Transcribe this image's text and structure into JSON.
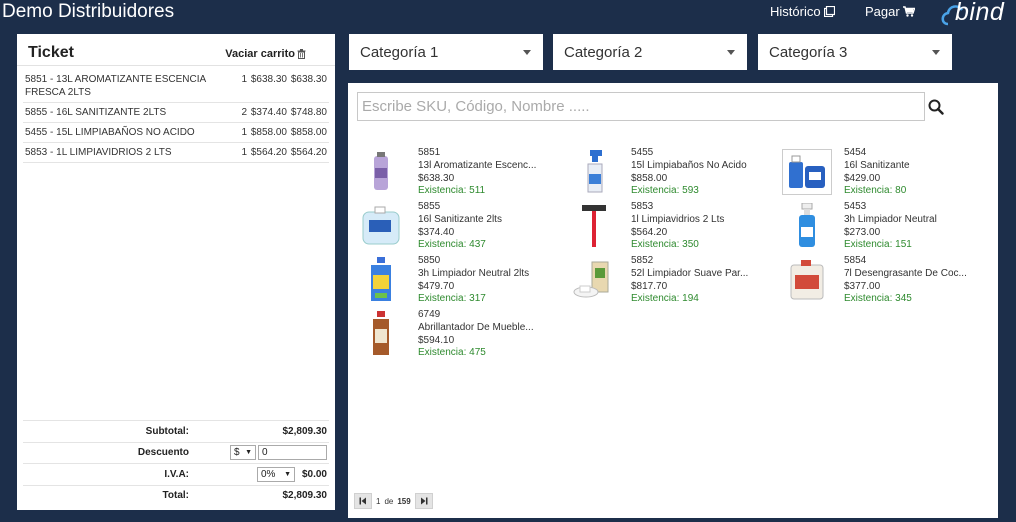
{
  "header": {
    "title": "Demo Distribuidores",
    "history_label": "Histórico",
    "pay_label": "Pagar",
    "logo_text": "bind"
  },
  "ticket": {
    "title": "Ticket",
    "empty_cart_label": "Vaciar carrito",
    "items": [
      {
        "desc": "5851 - 13L AROMATIZANTE ESCENCIA FRESCA 2LTS",
        "qty": "1",
        "price": "$638.30",
        "total": "$638.30"
      },
      {
        "desc": "5855 - 16L SANITIZANTE 2LTS",
        "qty": "2",
        "price": "$374.40",
        "total": "$748.80"
      },
      {
        "desc": "5455 - 15L LIMPIABAÑOS NO ACIDO",
        "qty": "1",
        "price": "$858.00",
        "total": "$858.00"
      },
      {
        "desc": "5853 - 1L LIMPIAVIDRIOS 2 LTS",
        "qty": "1",
        "price": "$564.20",
        "total": "$564.20"
      }
    ],
    "subtotal_label": "Subtotal:",
    "subtotal": "$2,809.30",
    "discount_label": "Descuento",
    "discount_type": "$",
    "discount_value": "0",
    "iva_label": "I.V.A:",
    "iva_rate": "0%",
    "iva_value": "$0.00",
    "total_label": "Total:",
    "total": "$2,809.30"
  },
  "categories": [
    "Categoría 1",
    "Categoría 2",
    "Categoría 3"
  ],
  "search": {
    "placeholder": "Escribe SKU, Código, Nombre ....."
  },
  "products": [
    {
      "sku": "5851",
      "name": "13l Aromatizante Escenc...",
      "price": "$638.30",
      "stock": "Existencia: 511",
      "icon": "aerosol-can"
    },
    {
      "sku": "5455",
      "name": "15l Limpiabaños No Acido",
      "price": "$858.00",
      "stock": "Existencia: 593",
      "icon": "spray-bottle"
    },
    {
      "sku": "5454",
      "name": "16l Sanitizante",
      "price": "$429.00",
      "stock": "Existencia: 80",
      "icon": "sanitizer-bottles"
    },
    {
      "sku": "5855",
      "name": "16l Sanitizante 2lts",
      "price": "$374.40",
      "stock": "Existencia: 437",
      "icon": "jug"
    },
    {
      "sku": "5853",
      "name": "1l Limpiavidrios 2 Lts",
      "price": "$564.20",
      "stock": "Existencia: 350",
      "icon": "squeegee"
    },
    {
      "sku": "5453",
      "name": "3h Limpiador Neutral",
      "price": "$273.00",
      "stock": "Existencia: 151",
      "icon": "blue-spray-bottle"
    },
    {
      "sku": "5850",
      "name": "3h Limpiador Neutral 2lts",
      "price": "$479.70",
      "stock": "Existencia: 317",
      "icon": "cleaner-bottle"
    },
    {
      "sku": "5852",
      "name": "52l Limpiador Suave Par...",
      "price": "$817.70",
      "stock": "Existencia: 194",
      "icon": "soft-cleaner-pack"
    },
    {
      "sku": "5854",
      "name": "7l Desengrasante De Coc...",
      "price": "$377.00",
      "stock": "Existencia: 345",
      "icon": "degreaser-jug"
    },
    {
      "sku": "6749",
      "name": "Abrillantador De Mueble...",
      "price": "$594.10",
      "stock": "Existencia: 475",
      "icon": "polish-bottle"
    }
  ],
  "pager": {
    "current": "1",
    "of": "de",
    "total": "159"
  }
}
